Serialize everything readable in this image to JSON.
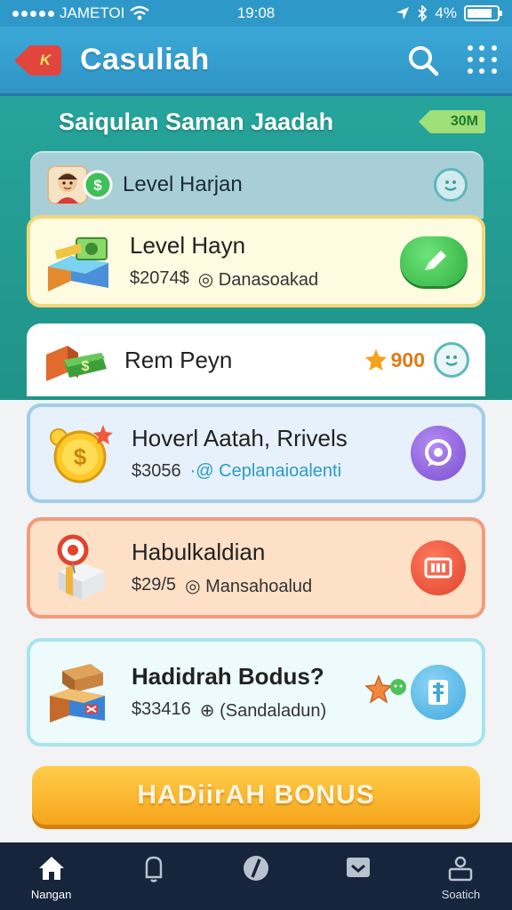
{
  "status_bar": {
    "carrier": "JAMETOI",
    "time": "19:08",
    "battery": "4%",
    "battery_level": 0.85
  },
  "header": {
    "back_label": "K",
    "title": "Casuliah",
    "icons": [
      "search-icon",
      "grid-menu-icon"
    ]
  },
  "section": {
    "title": "Saiqulan Saman Jaadah",
    "badge": "30M"
  },
  "cards": [
    {
      "title": "Level Harjan",
      "thumb": "avatar-coin-icon",
      "action_icon": "smiley-chat-icon"
    },
    {
      "title": "Level Hayn",
      "price": "$2074$",
      "meta": "◎ Danasoakad",
      "thumb": "cash-stack-icon",
      "action_icon": "edit-pencil-icon"
    },
    {
      "title": "Rem Peyn",
      "points": "900",
      "thumb": "money-bundle-icon",
      "action_icon": "smiley-chat-icon"
    },
    {
      "title": "Hoverl Aatah, Rrivels",
      "price": "$3056",
      "meta": "·@ Ceplanaioalenti",
      "thumb": "gold-coin-icon",
      "action_icon": "chat-bubble-icon"
    },
    {
      "title": "Habulkaldian",
      "price": "$29/5",
      "meta": "◎ Mansahoalud",
      "thumb": "gift-box-icon",
      "action_icon": "badge-icon"
    },
    {
      "title": "Hadidrah Bodus?",
      "price": "$33416",
      "meta": "⊕ (Sandaladun)",
      "thumb": "treasure-chest-icon",
      "action_icon": "receipt-icon"
    }
  ],
  "bonus_button": {
    "label": "HADiirAH BONUS"
  },
  "bottom_nav": [
    {
      "label": "Nangan",
      "icon": "home-icon",
      "active": true
    },
    {
      "label": "",
      "icon": "bell-icon",
      "active": false
    },
    {
      "label": "",
      "icon": "compass-icon",
      "active": false
    },
    {
      "label": "",
      "icon": "inbox-icon",
      "active": false
    },
    {
      "label": "Soatich",
      "icon": "profile-icon",
      "active": false
    }
  ],
  "colors": {
    "header": "#2f95c6",
    "teal": "#23a095",
    "bonus": "#f7a51c",
    "nav": "#16253b"
  }
}
